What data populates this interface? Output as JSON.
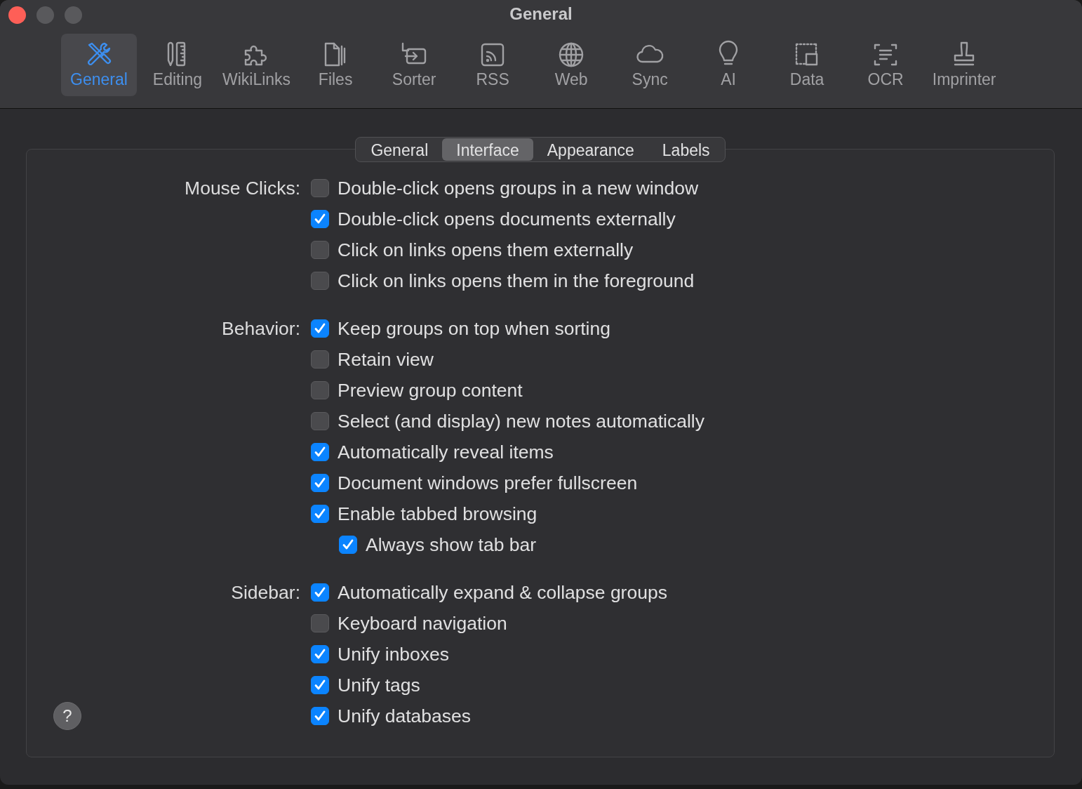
{
  "window": {
    "title": "General"
  },
  "toolbar": [
    {
      "label": "General",
      "selected": true
    },
    {
      "label": "Editing",
      "selected": false
    },
    {
      "label": "WikiLinks",
      "selected": false
    },
    {
      "label": "Files",
      "selected": false
    },
    {
      "label": "Sorter",
      "selected": false
    },
    {
      "label": "RSS",
      "selected": false
    },
    {
      "label": "Web",
      "selected": false
    },
    {
      "label": "Sync",
      "selected": false
    },
    {
      "label": "AI",
      "selected": false
    },
    {
      "label": "Data",
      "selected": false
    },
    {
      "label": "OCR",
      "selected": false
    },
    {
      "label": "Imprinter",
      "selected": false
    }
  ],
  "tabs": [
    {
      "label": "General",
      "selected": false
    },
    {
      "label": "Interface",
      "selected": true
    },
    {
      "label": "Appearance",
      "selected": false
    },
    {
      "label": "Labels",
      "selected": false
    }
  ],
  "groups": [
    {
      "label": "Mouse Clicks:",
      "options": [
        {
          "label": "Double-click opens groups in a new window",
          "checked": false
        },
        {
          "label": "Double-click opens documents externally",
          "checked": true
        },
        {
          "label": "Click on links opens them externally",
          "checked": false
        },
        {
          "label": "Click on links opens them in the foreground",
          "checked": false
        }
      ]
    },
    {
      "label": "Behavior:",
      "options": [
        {
          "label": "Keep groups on top when sorting",
          "checked": true
        },
        {
          "label": "Retain view",
          "checked": false
        },
        {
          "label": "Preview group content",
          "checked": false
        },
        {
          "label": "Select (and display) new notes automatically",
          "checked": false
        },
        {
          "label": "Automatically reveal items",
          "checked": true
        },
        {
          "label": "Document windows prefer fullscreen",
          "checked": true
        },
        {
          "label": "Enable tabbed browsing",
          "checked": true,
          "children": [
            {
              "label": "Always show tab bar",
              "checked": true
            }
          ]
        }
      ]
    },
    {
      "label": "Sidebar:",
      "options": [
        {
          "label": "Automatically expand & collapse groups",
          "checked": true
        },
        {
          "label": "Keyboard navigation",
          "checked": false
        },
        {
          "label": "Unify inboxes",
          "checked": true
        },
        {
          "label": "Unify tags",
          "checked": true
        },
        {
          "label": "Unify databases",
          "checked": true
        }
      ]
    }
  ],
  "help_button": {
    "label": "?"
  }
}
